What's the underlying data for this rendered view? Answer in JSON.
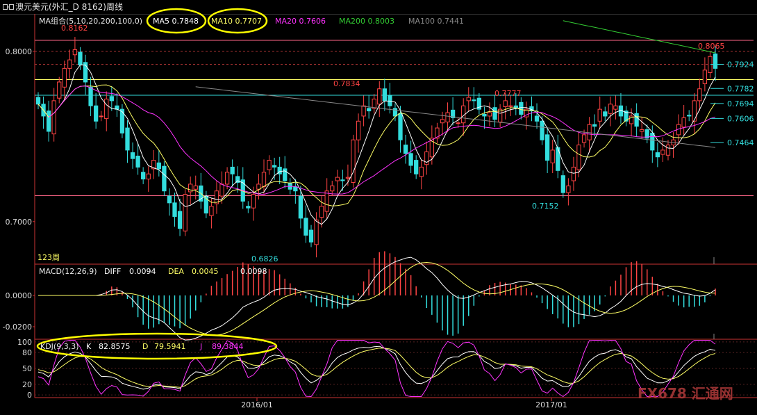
{
  "window": {
    "title": "澳元美元(外汇_D 8162)周线"
  },
  "ma_legend": [
    {
      "label": "MA组合(5,10,20,200,100,0)",
      "color": "#e8e8e8"
    },
    {
      "label": "MA5 0.7848",
      "color": "#ffffff"
    },
    {
      "label": "MA10 0.7707",
      "color": "#ffff66"
    },
    {
      "label": "MA20 0.7606",
      "color": "#ff33ff"
    },
    {
      "label": "MA200 0.8003",
      "color": "#33cc33"
    },
    {
      "label": "MA100 0.7441",
      "color": "#888888"
    }
  ],
  "period_label": "123周",
  "macd_legend": {
    "name": "MACD(12,26,9)",
    "diff_label": "DIFF",
    "diff": "0.0094",
    "dea_label": "DEA",
    "dea": "0.0045",
    "macd": "0.0098"
  },
  "kdj_legend": {
    "name": "KDJ(9,3,3)",
    "k_label": "K",
    "k": "82.8575",
    "d_label": "D",
    "d": "79.5941",
    "j_label": "J",
    "j": "89.3844"
  },
  "watermark": {
    "text": "FX678 汇通网"
  },
  "colors": {
    "up": "#ff4444",
    "down": "#33dddd",
    "ma5": "#ffffff",
    "ma10": "#ffff66",
    "ma20": "#ff33ff",
    "ma200": "#33cc33",
    "ma100": "#888888",
    "axis": "#cc3333",
    "highlight": "#ffff00"
  },
  "chart_data": [
    {
      "type": "candlestick",
      "title": "澳元美元(外汇_D 8162)周线",
      "ylim": [
        0.675,
        0.822
      ],
      "y_ticks": [
        "0.8000",
        "0.7000"
      ],
      "x_tick_labels": [
        "2016/01",
        "2017/01"
      ],
      "series_close": [
        0.769,
        0.762,
        0.753,
        0.771,
        0.782,
        0.79,
        0.795,
        0.801,
        0.792,
        0.782,
        0.768,
        0.759,
        0.762,
        0.772,
        0.771,
        0.766,
        0.752,
        0.742,
        0.737,
        0.732,
        0.725,
        0.728,
        0.736,
        0.731,
        0.718,
        0.711,
        0.703,
        0.696,
        0.716,
        0.722,
        0.721,
        0.712,
        0.705,
        0.709,
        0.718,
        0.722,
        0.729,
        0.728,
        0.723,
        0.712,
        0.708,
        0.716,
        0.722,
        0.729,
        0.736,
        0.732,
        0.728,
        0.724,
        0.719,
        0.718,
        0.702,
        0.692,
        0.688,
        0.701,
        0.709,
        0.718,
        0.721,
        0.726,
        0.724,
        0.726,
        0.748,
        0.759,
        0.768,
        0.765,
        0.772,
        0.778,
        0.771,
        0.768,
        0.762,
        0.748,
        0.74,
        0.733,
        0.728,
        0.732,
        0.741,
        0.749,
        0.755,
        0.76,
        0.764,
        0.761,
        0.758,
        0.768,
        0.773,
        0.771,
        0.766,
        0.762,
        0.764,
        0.76,
        0.766,
        0.771,
        0.768,
        0.767,
        0.763,
        0.766,
        0.765,
        0.759,
        0.748,
        0.736,
        0.742,
        0.73,
        0.717,
        0.721,
        0.732,
        0.745,
        0.751,
        0.757,
        0.756,
        0.766,
        0.762,
        0.769,
        0.768,
        0.762,
        0.759,
        0.762,
        0.756,
        0.754,
        0.749,
        0.742,
        0.738,
        0.742,
        0.745,
        0.748,
        0.757,
        0.761,
        0.762,
        0.771,
        0.778,
        0.789,
        0.797,
        0.79
      ],
      "annotations": [
        {
          "label": "0.8162",
          "value": 0.8162,
          "color": "#ff4444"
        },
        {
          "label": "0.7834",
          "value": 0.7834,
          "color": "#ff4444"
        },
        {
          "label": "0.7777",
          "value": 0.7777,
          "color": "#ff4444"
        },
        {
          "label": "0.8065",
          "value": 0.8065,
          "color": "#ff4444"
        },
        {
          "label": "0.6826",
          "value": 0.6826,
          "color": "#33dddd"
        },
        {
          "label": "0.7152",
          "value": 0.7152,
          "color": "#33dddd"
        }
      ],
      "right_levels": [
        {
          "label": "0.7924",
          "value": 0.7924
        },
        {
          "label": "0.7782",
          "value": 0.7782
        },
        {
          "label": "0.7694",
          "value": 0.7694
        },
        {
          "label": "0.7606",
          "value": 0.7606
        },
        {
          "label": "0.7464",
          "value": 0.7464
        }
      ],
      "horizontal_lines": [
        {
          "value": 0.8065,
          "color": "#ff6688"
        },
        {
          "value": 0.7834,
          "color": "#ffff66"
        },
        {
          "value": 0.7742,
          "color": "#33dddd"
        },
        {
          "value": 0.7152,
          "color": "#ff6688"
        }
      ]
    },
    {
      "type": "bar",
      "title": "MACD(12,26,9)",
      "ylim": [
        -0.028,
        0.02
      ],
      "y_ticks": [
        "0.0000",
        "-0.0200"
      ],
      "series": [
        {
          "name": "DIFF",
          "values": [
            0.0094
          ]
        },
        {
          "name": "DEA",
          "values": [
            0.0045
          ]
        }
      ]
    },
    {
      "type": "line",
      "title": "KDJ(9,3,3)",
      "ylim": [
        -5,
        105
      ],
      "y_ticks": [
        "100",
        "80",
        "50",
        "20",
        "0"
      ],
      "series": [
        {
          "name": "K",
          "values": [
            82.8575
          ]
        },
        {
          "name": "D",
          "values": [
            79.5941
          ]
        },
        {
          "name": "J",
          "values": [
            89.3844
          ]
        }
      ]
    }
  ]
}
